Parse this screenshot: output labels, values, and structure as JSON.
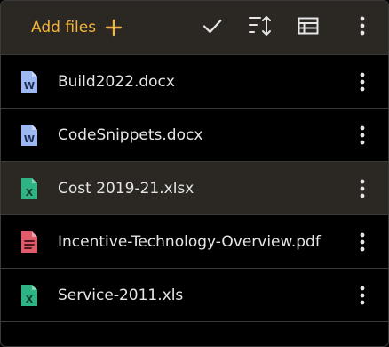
{
  "toolbar": {
    "add_files_label": "Add files",
    "icons": {
      "add": "plus-icon",
      "select": "checkmark-icon",
      "sort": "sort-icon",
      "view": "table-view-icon",
      "more": "more-vertical-icon"
    }
  },
  "files": [
    {
      "name": "Build2022.docx",
      "type": "word",
      "selected": false
    },
    {
      "name": "CodeSnippets.docx",
      "type": "word",
      "selected": false
    },
    {
      "name": "Cost 2019-21.xlsx",
      "type": "excel",
      "selected": true
    },
    {
      "name": "Incentive-Technology-Overview.pdf",
      "type": "pdf",
      "selected": false
    },
    {
      "name": "Service-2011.xls",
      "type": "excel",
      "selected": false
    }
  ],
  "colors": {
    "accent": "#f3b43a",
    "toolbar_bg": "#2b2722",
    "selected_row_bg": "#2b2722",
    "word": "#9db8f0",
    "excel": "#2fb384",
    "pdf": "#e05a6a"
  }
}
